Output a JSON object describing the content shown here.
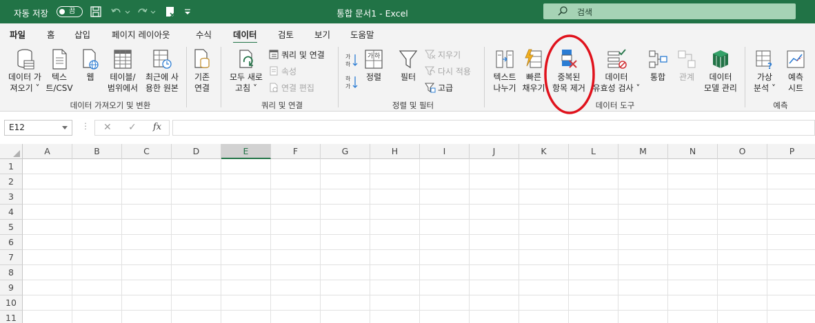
{
  "titlebar": {
    "autosave_label": "자동 저장",
    "autosave_state": "끔",
    "doc_title": "통합 문서1  -  Excel",
    "search_label": "검색"
  },
  "tabs": [
    {
      "label": "파일"
    },
    {
      "label": "홈"
    },
    {
      "label": "삽입"
    },
    {
      "label": "페이지 레이아웃"
    },
    {
      "label": "수식"
    },
    {
      "label": "데이터"
    },
    {
      "label": "검토"
    },
    {
      "label": "보기"
    },
    {
      "label": "도움말"
    }
  ],
  "ribbon": {
    "get_data_group": {
      "label": "데이터 가져오기 및 변환",
      "get_data": [
        "데이터 가",
        "져오기 ˅"
      ],
      "text_csv": [
        "텍스",
        "트/CSV"
      ],
      "web": [
        "웹"
      ],
      "table_range": [
        "테이블/",
        "범위에서"
      ],
      "recent_sources": [
        "최근에 사",
        "용한 원본"
      ],
      "existing": [
        "기존",
        "연결"
      ]
    },
    "queries_group": {
      "label": "쿼리 및 연결",
      "refresh_all": [
        "모두 새로",
        "고침 ˅"
      ],
      "queries_connections": "쿼리 및 연결",
      "properties": "속성",
      "edit_links": "연결 편집"
    },
    "sort_group": {
      "label": "정렬 및 필터",
      "sort": "정렬",
      "filter": "필터",
      "clear": "지우기",
      "reapply": "다시 적용",
      "advanced": "고급"
    },
    "tools_group": {
      "label": "데이터 도구",
      "text_to_columns": [
        "텍스트",
        "나누기"
      ],
      "flash_fill": [
        "빠른",
        "채우기"
      ],
      "remove_duplicates": [
        "중복된",
        "항목 제거"
      ],
      "data_validation": [
        "데이터",
        "유효성 검사 ˅"
      ],
      "consolidate": "통합",
      "relationships": "관계",
      "data_model": [
        "데이터",
        "모델 관리"
      ]
    },
    "forecast_group": {
      "label": "예측",
      "what_if": [
        "가상",
        "분석 ˅"
      ],
      "forecast_sheet": [
        "예측",
        "시트"
      ]
    }
  },
  "formula_bar": {
    "name_box": "E12",
    "cancel_icon": "✕",
    "enter_icon": "✓",
    "fx_label": "fx",
    "formula": ""
  },
  "grid": {
    "columns": [
      "A",
      "B",
      "C",
      "D",
      "E",
      "F",
      "G",
      "H",
      "I",
      "J",
      "K",
      "L",
      "M",
      "N",
      "O",
      "P"
    ],
    "selected_column": "E",
    "rows": [
      "1",
      "2",
      "3",
      "4",
      "5",
      "6",
      "7",
      "8",
      "9",
      "10",
      "11"
    ]
  },
  "colors": {
    "brand": "#217346",
    "ribbon_bg": "#f3f3f3",
    "annotation": "#e0121c"
  }
}
